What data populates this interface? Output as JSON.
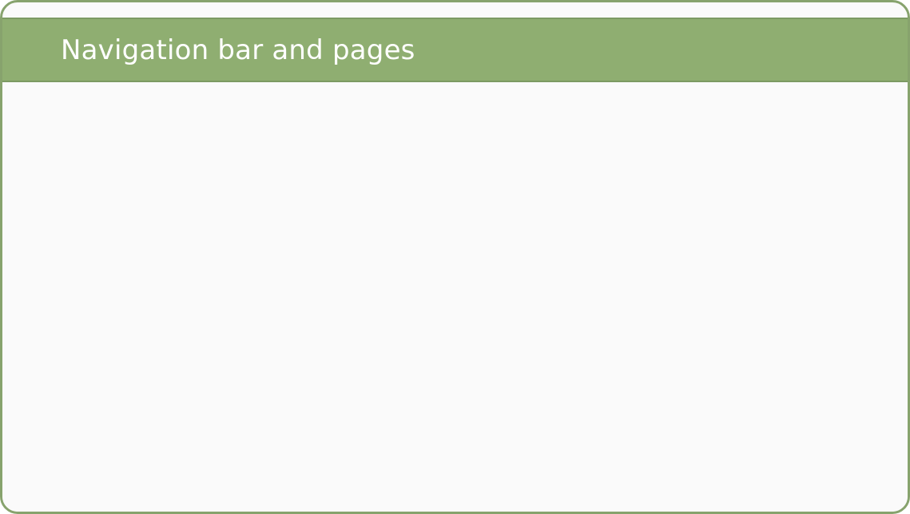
{
  "navbar": {
    "title": "Navigation bar and pages"
  },
  "colors": {
    "frame_border": "#87a36d",
    "navbar_background": "#8fae71",
    "navbar_text": "#ffffff",
    "content_background": "#fafafa"
  }
}
